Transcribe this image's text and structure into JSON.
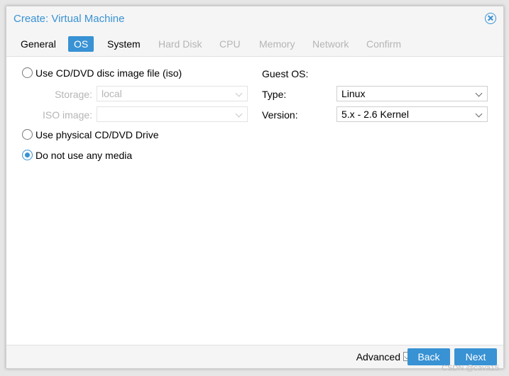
{
  "window": {
    "title": "Create: Virtual Machine"
  },
  "tabs": [
    {
      "label": "General",
      "state": "normal"
    },
    {
      "label": "OS",
      "state": "active"
    },
    {
      "label": "System",
      "state": "normal"
    },
    {
      "label": "Hard Disk",
      "state": "disabled"
    },
    {
      "label": "CPU",
      "state": "disabled"
    },
    {
      "label": "Memory",
      "state": "disabled"
    },
    {
      "label": "Network",
      "state": "disabled"
    },
    {
      "label": "Confirm",
      "state": "disabled"
    }
  ],
  "media": {
    "iso_option": {
      "label": "Use CD/DVD disc image file (iso)",
      "checked": false
    },
    "storage": {
      "label": "Storage:",
      "value": "local"
    },
    "iso_image": {
      "label": "ISO image:",
      "value": ""
    },
    "physical_option": {
      "label": "Use physical CD/DVD Drive",
      "checked": false
    },
    "none_option": {
      "label": "Do not use any media",
      "checked": true
    }
  },
  "guest_os": {
    "heading": "Guest OS:",
    "type": {
      "label": "Type:",
      "value": "Linux"
    },
    "version": {
      "label": "Version:",
      "value": "5.x - 2.6 Kernel"
    }
  },
  "footer": {
    "advanced_label": "Advanced",
    "back_label": "Back",
    "next_label": "Next"
  },
  "watermark": "CSDN @cava15",
  "colors": {
    "accent": "#3892d4",
    "disabled_text": "#b5b5b5"
  }
}
